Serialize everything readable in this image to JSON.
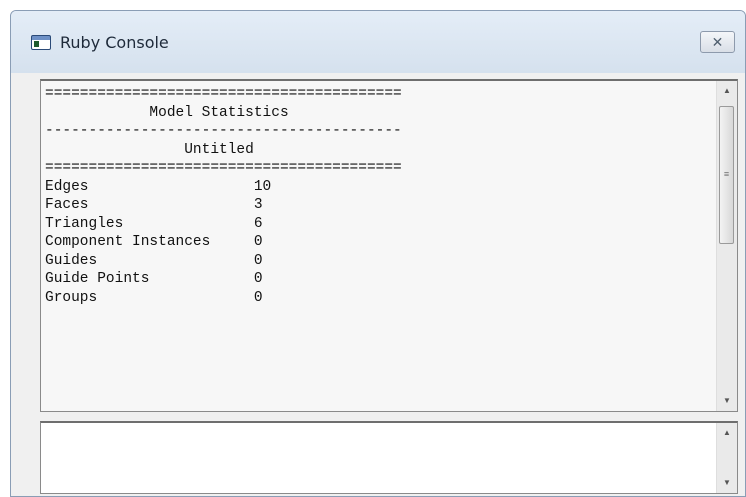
{
  "window": {
    "title": "Ruby Console",
    "icon": "ruby-console-window-icon",
    "close_glyph": "✕"
  },
  "output": {
    "lines": [
      "=========================================",
      "            Model Statistics",
      "-----------------------------------------",
      "                Untitled",
      "=========================================",
      "Edges                   10",
      "Faces                   3",
      "Triangles               6",
      "Component Instances     0",
      "Guides                  0",
      "Guide Points            0",
      "Groups                  0"
    ]
  },
  "input": {
    "value": ""
  },
  "scrollbar": {
    "up_glyph": "▲",
    "down_glyph": "▼",
    "grip_glyph": "≡"
  }
}
